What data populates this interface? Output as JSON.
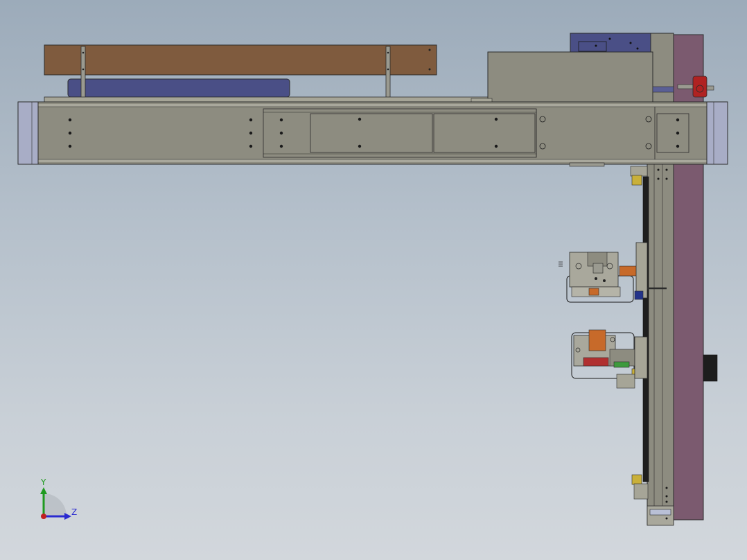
{
  "viewport": {
    "background_top": "#9cabba",
    "background_bottom": "#d2d7dc"
  },
  "colors": {
    "frame_gray": "#8d8c80",
    "frame_light": "#a9a89c",
    "outline": "#2b2b2b",
    "wood_board": "#7f5b3e",
    "blue_pad": "#4a4f86",
    "mauve_plate": "#7b5a6f",
    "end_cap": "#a8adc6",
    "yellow_stop": "#c9b03a",
    "red_valve": "#b02222",
    "orange_part": "#c76a2a",
    "green_part": "#3d9a3d",
    "blue_part": "#23338a",
    "axis_y": "#1f9a1f",
    "axis_z": "#2a2ad0",
    "axis_x": "#c02020"
  },
  "triad": {
    "y_label": "Y",
    "z_label": "Z",
    "icons": [
      "y-axis-arrow-icon",
      "z-axis-arrow-icon",
      "x-axis-dot-icon"
    ]
  }
}
